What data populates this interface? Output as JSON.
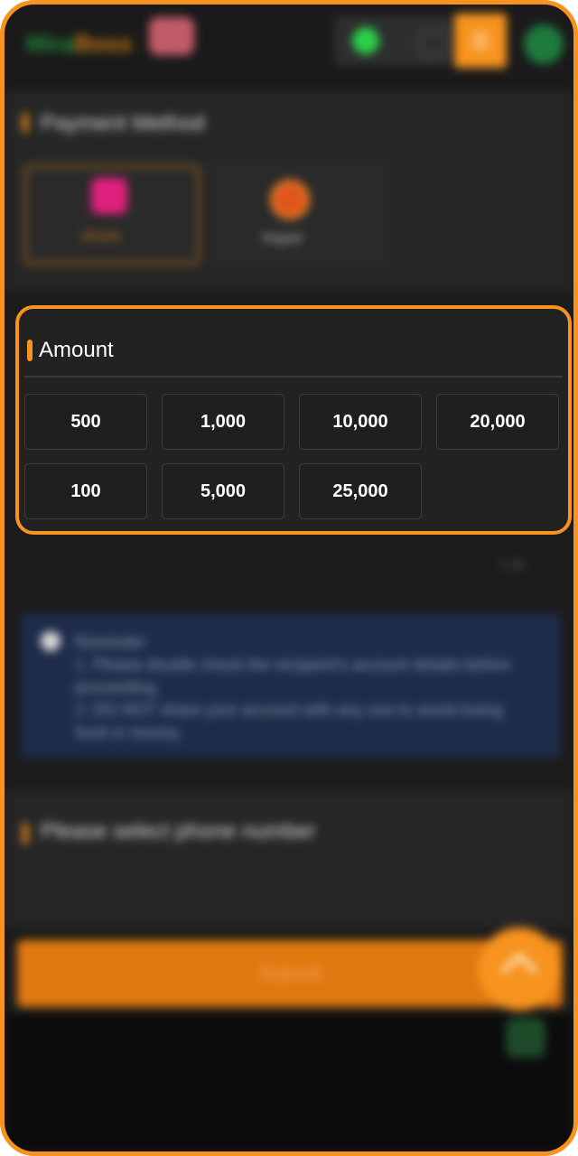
{
  "header": {
    "logo_part1": "Mira",
    "logo_part2": "Boss"
  },
  "payment_method": {
    "title": "Payment Method",
    "options": [
      {
        "label": "bKash",
        "selected": true
      },
      {
        "label": "Nagad",
        "selected": false
      }
    ]
  },
  "amount": {
    "title": "Amount",
    "options": [
      "500",
      "1,000",
      "10,000",
      "20,000",
      "100",
      "5,000",
      "25,000"
    ]
  },
  "range_hint": "1-30",
  "reminder": {
    "title": "Reminder",
    "line1": "1. Please double check the recipient's account details before proceeding.",
    "line2": "2. DO NOT share your account with any one to avoid losing fund or money."
  },
  "phone_section": {
    "title": "Please select phone number"
  },
  "submit_label": "Submit",
  "colors": {
    "accent": "#f7931e",
    "panel_bg": "#222222",
    "button_bg": "#1f1f1f"
  }
}
